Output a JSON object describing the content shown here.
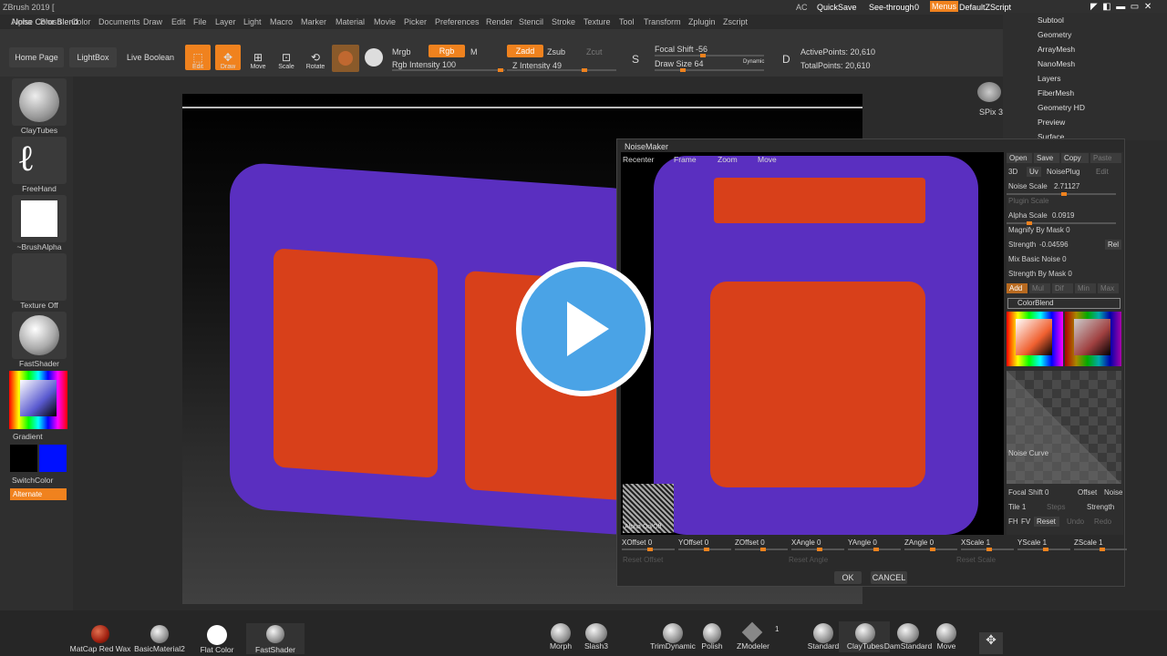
{
  "app": {
    "title": "ZBrush 2019 [",
    "subtitle": "Noise Color Blend"
  },
  "menu": [
    "Alpha",
    "Brush",
    "Color",
    "Documents",
    "Draw",
    "Edit",
    "File",
    "Layer",
    "Light",
    "Macro",
    "Marker",
    "Material",
    "Movie",
    "Picker",
    "Preferences",
    "Render",
    "Stencil",
    "Stroke",
    "Texture",
    "Tool",
    "Transform",
    "Zplugin",
    "Zscript"
  ],
  "topright": {
    "ac": "AC",
    "quicksave": "QuickSave",
    "seethrough": "See-through",
    "seethrough_val": "0",
    "menus": "Menus",
    "script": "DefaultZScript"
  },
  "toolbar": {
    "home": "Home Page",
    "lightbox": "LightBox",
    "liveboolean": "Live Boolean",
    "edit": "Edit",
    "draw": "Draw",
    "move": "Move",
    "scale": "Scale",
    "rotate": "Rotate",
    "mrgb": "Mrgb",
    "rgb": "Rgb",
    "m": "M",
    "rgb_intensity": "Rgb Intensity 100",
    "zadd": "Zadd",
    "zsub": "Zsub",
    "zcut": "Zcut",
    "z_intensity": "Z Intensity 49",
    "focal_shift": "Focal Shift -56",
    "draw_size": "Draw Size 64",
    "dynamic": "Dynamic",
    "active_points": "ActivePoints: 20,610",
    "total_points": "TotalPoints: 20,610",
    "spix": "SPix 3",
    "s_label": "S",
    "d_label": "D"
  },
  "left": {
    "claytubes": "ClayTubes",
    "freehand": "FreeHand",
    "brushalpha": "~BrushAlpha",
    "textureoff": "Texture Off",
    "fastshader": "FastShader",
    "gradient": "Gradient",
    "switchcolor": "SwitchColor",
    "alternate": "Alternate"
  },
  "rightmenu": [
    "Subtool",
    "Geometry",
    "ArrayMesh",
    "NanoMesh",
    "Layers",
    "FiberMesh",
    "Geometry HD",
    "Preview",
    "Surface"
  ],
  "noisemaker": {
    "title": "NoiseMaker",
    "view_buttons": [
      "Recenter",
      "Frame",
      "Zoom",
      "Move"
    ],
    "alpha_onoff": "Alpha On/Off",
    "open": "Open",
    "save": "Save",
    "copy": "Copy",
    "paste": "Paste",
    "tab3d": "3D",
    "tabuv": "Uv",
    "noiseplug": "NoisePlug",
    "edit": "Edit",
    "noise_scale": "Noise Scale",
    "noise_scale_val": "2.71127",
    "plugin_scale": "Plugin Scale",
    "alpha_scale": "Alpha Scale",
    "alpha_scale_val": "0.0919",
    "magnify": "Magnify By Mask 0",
    "strength": "Strength",
    "strength_val": "-0.04596",
    "rel": "Rel",
    "mix_basic": "Mix Basic Noise 0",
    "strength_mask": "Strength By Mask 0",
    "blend_modes": [
      "Add",
      "Mul",
      "Dif",
      "Min",
      "Max"
    ],
    "colorblend": "ColorBlend",
    "noise_curve": "Noise Curve",
    "focal": "Focal Shift 0",
    "offset": "Offset",
    "noise": "Noise",
    "tile": "Tile 1",
    "steps": "Steps",
    "strength2": "Strength",
    "fh": "FH",
    "fv": "FV",
    "reset": "Reset",
    "undo": "Undo",
    "redo": "Redo",
    "offsets": [
      "XOffset 0",
      "YOffset 0",
      "ZOffset 0",
      "XAngle 0",
      "YAngle 0",
      "ZAngle 0",
      "XScale 1",
      "YScale 1",
      "ZScale 1"
    ],
    "reset_offset": "Reset Offset",
    "reset_angle": "Reset Angle",
    "reset_scale": "Reset Scale",
    "ok": "OK",
    "cancel": "CANCEL"
  },
  "shelf": {
    "matcap": "MatCap Red Wax",
    "basic": "BasicMaterial2",
    "flat": "Flat Color",
    "fast": "FastShader",
    "morph": "Morph",
    "slash": "Slash3",
    "trim": "TrimDynamic",
    "polish": "Polish",
    "zmodeler": "ZModeler",
    "zmod_count": "1",
    "standard": "Standard",
    "claytubes": "ClayTubes",
    "damstandard": "DamStandard",
    "move": "Move"
  },
  "colors": {
    "accent": "#f0821e",
    "play": "#4aa3e6",
    "mesh": "#5a2fc0",
    "red": "#d8401a"
  }
}
